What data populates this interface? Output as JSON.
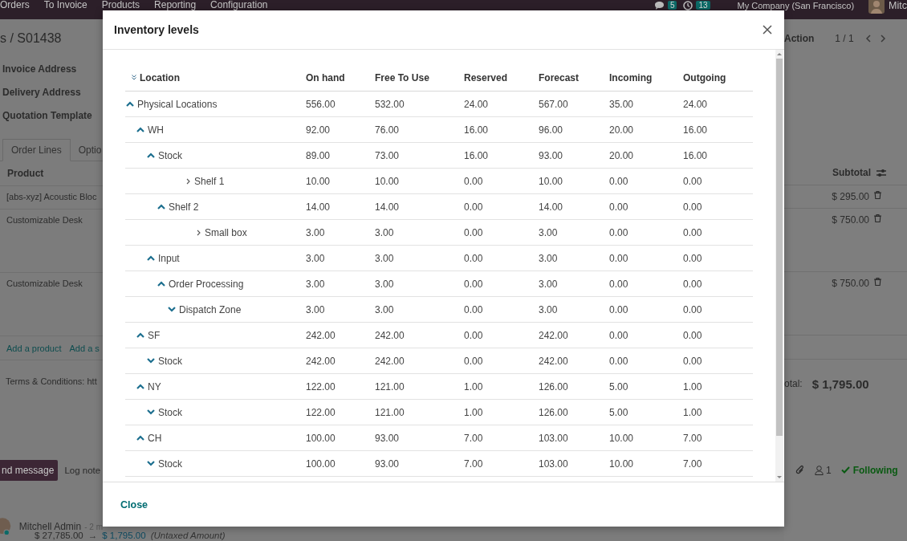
{
  "navbar": {
    "menu": [
      "Orders",
      "To Invoice",
      "Products",
      "Reporting",
      "Configuration"
    ],
    "chat_count": "5",
    "activity_count": "13",
    "company": "My Company (San Francisco)",
    "user": "Mitc"
  },
  "breadcrumb": "s / S01438",
  "control_panel": {
    "action": "Action",
    "pager": "1 / 1"
  },
  "form": {
    "fields": [
      "Invoice Address",
      "Delivery Address",
      "Quotation Template"
    ],
    "tabs": [
      {
        "label": "Order Lines",
        "selected": true
      },
      {
        "label": "Optio",
        "selected": false
      }
    ],
    "lines_header": {
      "product": "Product",
      "subtotal": "Subtotal"
    },
    "lines": [
      {
        "product": "[abs-xyz] Acoustic Bloc",
        "subtotal": "$ 295.00",
        "tall": false
      },
      {
        "product": "Customizable Desk",
        "subtotal": "$ 750.00",
        "tall": true
      },
      {
        "product": "Customizable Desk",
        "subtotal": "$ 750.00",
        "tall": true
      }
    ],
    "add_links": [
      "Add a product",
      "Add a s"
    ],
    "terms": "Terms & Conditions: htt",
    "total_label": "otal:",
    "total": "$ 1,795.00"
  },
  "chatter": {
    "send": "nd message",
    "log": "Log note",
    "followers": "1",
    "following": "Following",
    "message": {
      "author": "Mitchell Admin",
      "time": "- 2 m",
      "old": "$ 27,785.00",
      "arrow": "→",
      "new": "$ 1,795.00",
      "field": "(Untaxed Amount)"
    }
  },
  "dialog": {
    "title": "Inventory levels",
    "close": "Close",
    "columns": [
      "Location",
      "On hand",
      "Free To Use",
      "Reserved",
      "Forecast",
      "Incoming",
      "Outgoing"
    ],
    "rows": [
      {
        "location": "Physical Locations",
        "kind": "up",
        "values": [
          "556.00",
          "532.00",
          "24.00",
          "567.00",
          "35.00",
          "24.00"
        ],
        "children": [
          {
            "location": "WH",
            "kind": "up",
            "values": [
              "92.00",
              "76.00",
              "16.00",
              "96.00",
              "20.00",
              "16.00"
            ],
            "children": [
              {
                "location": "Stock",
                "kind": "up",
                "values": [
                  "89.00",
                  "73.00",
                  "16.00",
                  "93.00",
                  "20.00",
                  "16.00"
                ],
                "children": [
                  {
                    "location": "Shelf 1",
                    "kind": "right",
                    "values": [
                      "10.00",
                      "10.00",
                      "0.00",
                      "10.00",
                      "0.00",
                      "0.00"
                    ]
                  },
                  {
                    "location": "Shelf 2",
                    "kind": "up",
                    "values": [
                      "14.00",
                      "14.00",
                      "0.00",
                      "14.00",
                      "0.00",
                      "0.00"
                    ],
                    "children": [
                      {
                        "location": "Small box",
                        "kind": "right",
                        "values": [
                          "3.00",
                          "3.00",
                          "0.00",
                          "3.00",
                          "0.00",
                          "0.00"
                        ]
                      }
                    ]
                  }
                ]
              },
              {
                "location": "Input",
                "kind": "up",
                "values": [
                  "3.00",
                  "3.00",
                  "0.00",
                  "3.00",
                  "0.00",
                  "0.00"
                ],
                "children": [
                  {
                    "location": "Order Processing",
                    "kind": "up",
                    "values": [
                      "3.00",
                      "3.00",
                      "0.00",
                      "3.00",
                      "0.00",
                      "0.00"
                    ],
                    "children": [
                      {
                        "location": "Dispatch Zone",
                        "kind": "down",
                        "values": [
                          "3.00",
                          "3.00",
                          "0.00",
                          "3.00",
                          "0.00",
                          "0.00"
                        ]
                      }
                    ]
                  }
                ]
              }
            ]
          },
          {
            "location": "SF",
            "kind": "up",
            "values": [
              "242.00",
              "242.00",
              "0.00",
              "242.00",
              "0.00",
              "0.00"
            ],
            "children": [
              {
                "location": "Stock",
                "kind": "down",
                "values": [
                  "242.00",
                  "242.00",
                  "0.00",
                  "242.00",
                  "0.00",
                  "0.00"
                ]
              }
            ]
          },
          {
            "location": "NY",
            "kind": "up",
            "values": [
              "122.00",
              "121.00",
              "1.00",
              "126.00",
              "5.00",
              "1.00"
            ],
            "children": [
              {
                "location": "Stock",
                "kind": "down",
                "values": [
                  "122.00",
                  "121.00",
                  "1.00",
                  "126.00",
                  "5.00",
                  "1.00"
                ]
              }
            ]
          },
          {
            "location": "CH",
            "kind": "up",
            "values": [
              "100.00",
              "93.00",
              "7.00",
              "103.00",
              "10.00",
              "7.00"
            ],
            "children": [
              {
                "location": "Stock",
                "kind": "down",
                "values": [
                  "100.00",
                  "93.00",
                  "7.00",
                  "103.00",
                  "10.00",
                  "7.00"
                ]
              }
            ]
          }
        ]
      }
    ]
  }
}
